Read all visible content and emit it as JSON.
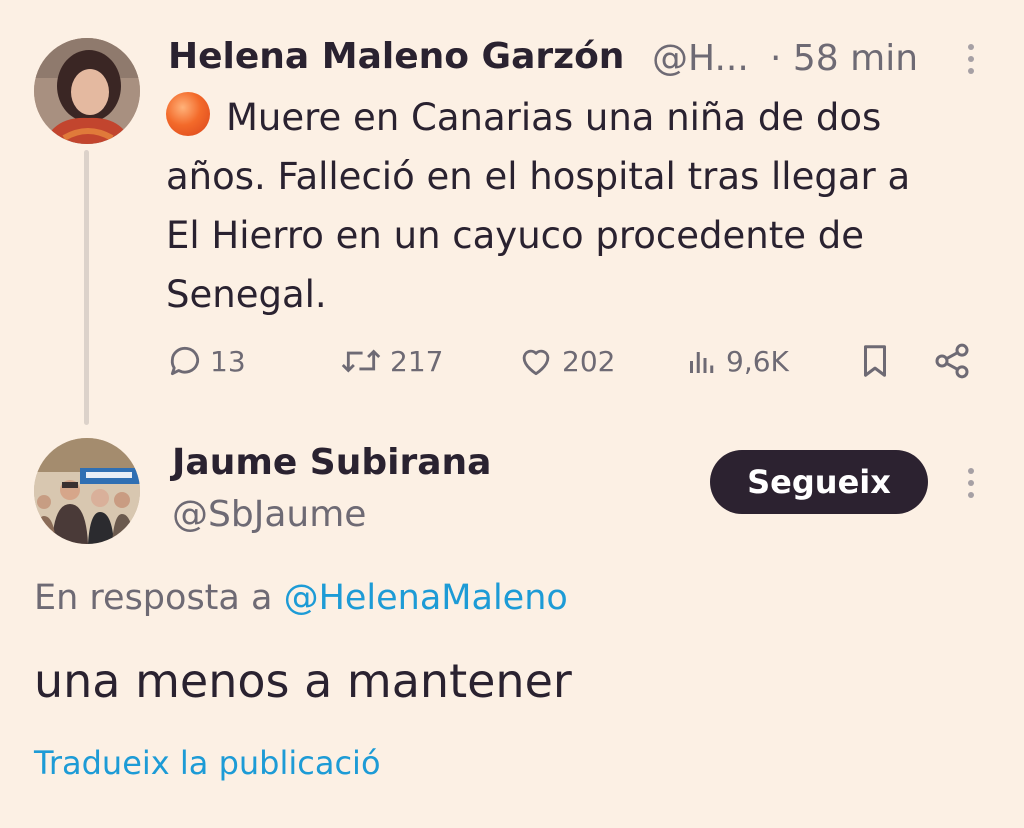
{
  "tweet": {
    "author_name": "Helena Maleno Garzón",
    "author_handle": "@H...",
    "time": "· 58 min",
    "avatar_icon": "avatar-photo-woman",
    "status_emoji": "orange-circle-emoji",
    "text_lines": [
      "Muere en Canarias una niña de dos",
      "años. Falleció en el hospital tras llegar a",
      "El Hierro en un cayuco procedente de",
      "Senegal."
    ],
    "actions": {
      "replies": "13",
      "reposts": "217",
      "likes": "202",
      "views": "9,6K"
    }
  },
  "reply": {
    "author_name": "Jaume Subirana",
    "author_handle": "@SbJaume",
    "follow_label": "Segueix",
    "avatar_icon": "avatar-photo-group",
    "reply_to_prefix": "En resposta a",
    "reply_to_mention": "@HelenaMaleno",
    "text": "una menos a mantener",
    "translate_label": "Tradueix la publicació"
  },
  "colors": {
    "background": "#fcf0e4",
    "text": "#2a2230",
    "muted": "#6e6a74",
    "link": "#1d9bd6",
    "button": "#2c2230"
  }
}
